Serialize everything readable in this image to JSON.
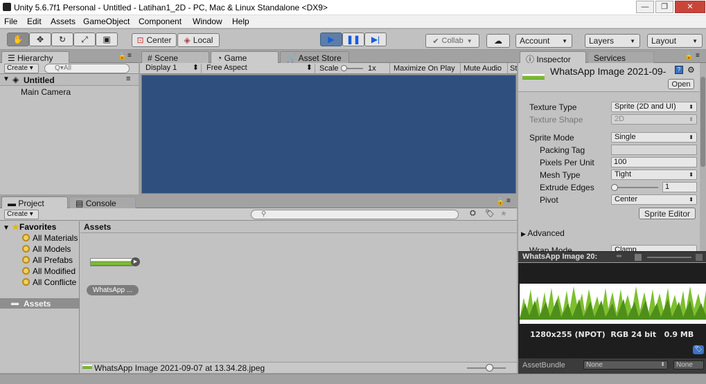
{
  "window": {
    "title": "Unity 5.6.7f1 Personal - Untitled - Latihan1_2D - PC, Mac & Linux Standalone <DX9>",
    "min": "—",
    "max": "❐",
    "close": "✕"
  },
  "menu": [
    "File",
    "Edit",
    "Assets",
    "GameObject",
    "Component",
    "Window",
    "Help"
  ],
  "toolbar": {
    "pivot": "Center",
    "space": "Local",
    "collab": "Collab",
    "account": "Account",
    "layers": "Layers",
    "layout": "Layout"
  },
  "hierarchy": {
    "tab": "Hierarchy",
    "create": "Create",
    "search_placeholder": "Q▾All",
    "scene": "Untitled",
    "items": [
      "Main Camera"
    ]
  },
  "scene_tabs": {
    "scene": "Scene",
    "game": "Game",
    "store": "Asset Store"
  },
  "game_bar": {
    "display": "Display 1",
    "aspect": "Free Aspect",
    "scale_label": "Scale",
    "scale_value": "1x",
    "maximize": "Maximize On Play",
    "mute": "Mute Audio",
    "stats": "St"
  },
  "colors": {
    "game_bg": "#2f4f7f",
    "accent": "#3e71c5"
  },
  "project": {
    "tab": "Project",
    "console_tab": "Console",
    "create": "Create",
    "favorites_label": "Favorites",
    "favorites": [
      "All Materials",
      "All Models",
      "All Prefabs",
      "All Modified",
      "All Conflicte"
    ],
    "assets_folder": "Assets",
    "assets_header": "Assets",
    "asset_name": "WhatsApp ...",
    "status_file": "WhatsApp Image 2021-09-07 at 13.34.28.jpeg"
  },
  "inspector": {
    "tab": "Inspector",
    "services_tab": "Services",
    "title": "WhatsApp Image 2021-09-",
    "open": "Open",
    "rows": [
      {
        "label": "Texture Type",
        "value": "Sprite (2D and UI)"
      },
      {
        "label": "Texture Shape",
        "value": "2D"
      },
      {
        "label": "Sprite Mode",
        "value": "Single"
      },
      {
        "label": "Packing Tag",
        "value": ""
      },
      {
        "label": "Pixels Per Unit",
        "value": "100"
      },
      {
        "label": "Mesh Type",
        "value": "Tight"
      },
      {
        "label": "Extrude Edges",
        "value": "1"
      },
      {
        "label": "Pivot",
        "value": "Center"
      }
    ],
    "sprite_editor": "Sprite Editor",
    "advanced": "Advanced",
    "wrap_mode": "Wrap Mode",
    "wrap_value": "Clamp"
  },
  "preview": {
    "title": "WhatsApp Image 20:",
    "info": "1280x255 (NPOT)  RGB 24 bit   0.9 MB",
    "assetbundle_label": "AssetBundle",
    "bundle": "None",
    "variant": "None"
  }
}
